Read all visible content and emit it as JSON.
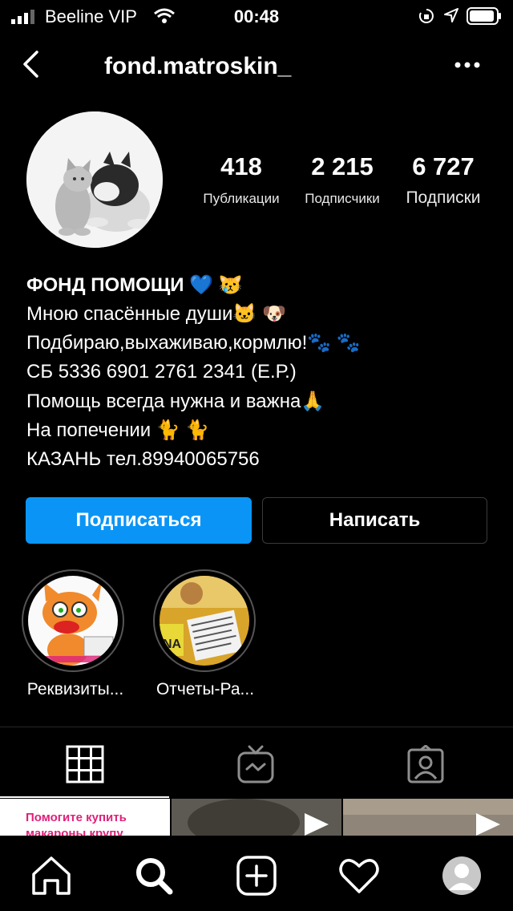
{
  "status_bar": {
    "carrier": "Beeline VIP",
    "time": "00:48",
    "icons": [
      "signal-icon",
      "wifi-icon",
      "rotation-lock-icon",
      "location-icon",
      "battery-icon"
    ]
  },
  "header": {
    "username": "fond.matroskin_",
    "icons": [
      "back-icon",
      "more-icon"
    ]
  },
  "stats": {
    "posts": {
      "count": "418",
      "label": "Публикации"
    },
    "followers": {
      "count": "2 215",
      "label": "Подписчики"
    },
    "following": {
      "count": "6 727",
      "label": "Подписки"
    }
  },
  "bio": {
    "name": "ФОНД ПОМОЩИ 💙 😿",
    "lines": [
      "Мною спасённые души🐱 🐶",
      "Подбираю,выхаживаю,кормлю!🐾 🐾",
      "СБ 5336 6901 2761 2341 (Е.Р.)",
      "Помощь всегда нужна и важна🙏",
      "На попечении 🐈 🐈",
      "КАЗАНЬ тел.89940065756"
    ]
  },
  "actions": {
    "follow_label": "Подписаться",
    "message_label": "Написать"
  },
  "highlights": [
    {
      "label": "Реквизиты..."
    },
    {
      "label": "Отчеты-Ра..."
    }
  ],
  "tabs": [
    "grid-icon",
    "igtv-icon",
    "tagged-icon"
  ],
  "grid": {
    "first_post_text": "Помогите купить макароны,крупу"
  },
  "bottom_nav": [
    "home-icon",
    "search-icon",
    "add-post-icon",
    "activity-icon",
    "profile-avatar"
  ],
  "colors": {
    "background": "#000000",
    "accent_blue": "#0a95f6",
    "heart_blue": "#1e6ee8"
  }
}
